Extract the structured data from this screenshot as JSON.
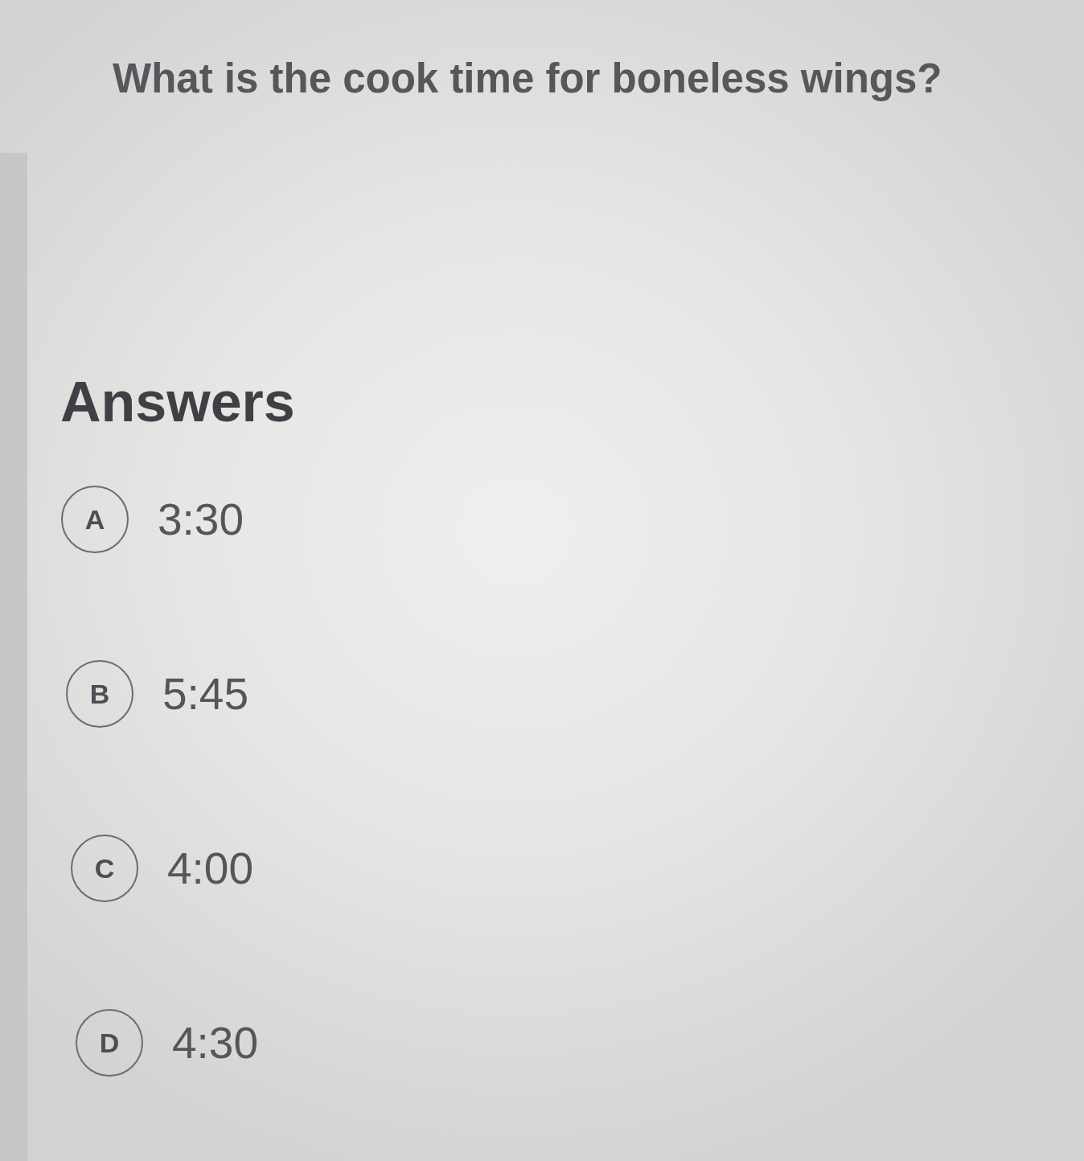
{
  "question": "What is the cook time for boneless wings?",
  "answers": {
    "heading": "Answers",
    "options": [
      {
        "letter": "A",
        "text": "3:30",
        "selected": false
      },
      {
        "letter": "B",
        "text": "5:45",
        "selected": false
      },
      {
        "letter": "C",
        "text": "4:00",
        "selected": false
      },
      {
        "letter": "D",
        "text": "4:30",
        "selected": false
      }
    ]
  }
}
